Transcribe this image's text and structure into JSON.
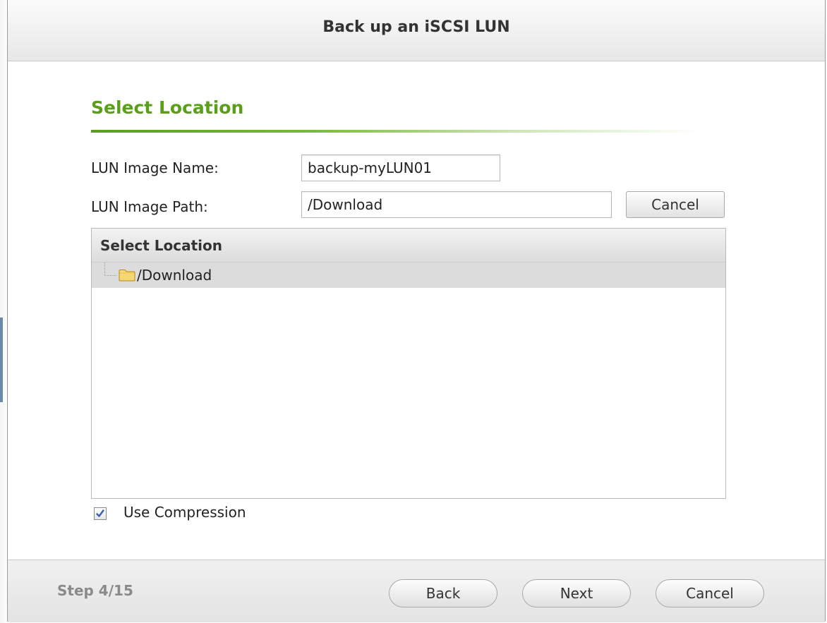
{
  "dialog": {
    "title": "Back up an iSCSI LUN"
  },
  "section": {
    "title": "Select Location"
  },
  "form": {
    "name_label": "LUN Image Name:",
    "name_value": "backup-myLUN01",
    "path_label": "LUN Image Path:",
    "path_value": "/Download",
    "path_cancel_label": "Cancel"
  },
  "tree": {
    "header": "Select Location",
    "items": [
      {
        "label": "/Download",
        "icon": "folder-icon",
        "selected": true
      }
    ]
  },
  "options": {
    "compression_label": "Use Compression",
    "compression_checked": true
  },
  "footer": {
    "step_text": "Step 4/15",
    "back_label": "Back",
    "next_label": "Next",
    "cancel_label": "Cancel"
  },
  "colors": {
    "accent": "#5a9f1a",
    "checkmark": "#3a5fb0",
    "folder_fill": "#f7d775",
    "folder_stroke": "#b48a1c"
  }
}
